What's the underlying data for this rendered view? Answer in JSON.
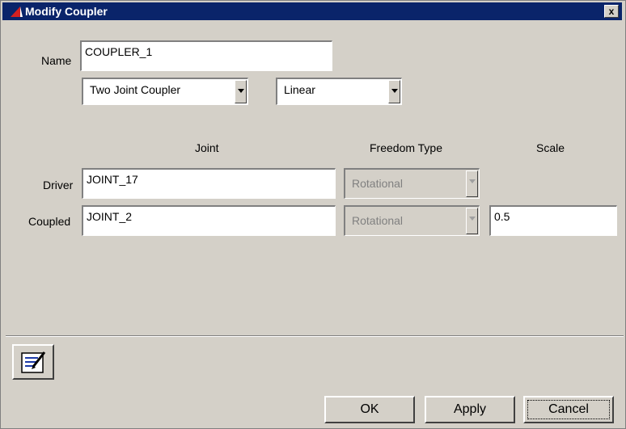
{
  "window": {
    "title": "Modify Coupler",
    "close_glyph": "x"
  },
  "name_row": {
    "label": "Name",
    "value": "COUPLER_1"
  },
  "coupler_type": {
    "selected": "Two Joint Coupler"
  },
  "relation_type": {
    "selected": "Linear"
  },
  "columns": {
    "joint": "Joint",
    "freedom_type": "Freedom Type",
    "scale": "Scale"
  },
  "driver": {
    "label": "Driver",
    "joint": "JOINT_17",
    "freedom_type": "Rotational"
  },
  "coupled": {
    "label": "Coupled",
    "joint": "JOINT_2",
    "freedom_type": "Rotational",
    "scale": "0.5"
  },
  "buttons": {
    "ok": "OK",
    "apply": "Apply",
    "cancel": "Cancel"
  },
  "icons": {
    "title": "app-icon",
    "comments": "comments-icon"
  }
}
